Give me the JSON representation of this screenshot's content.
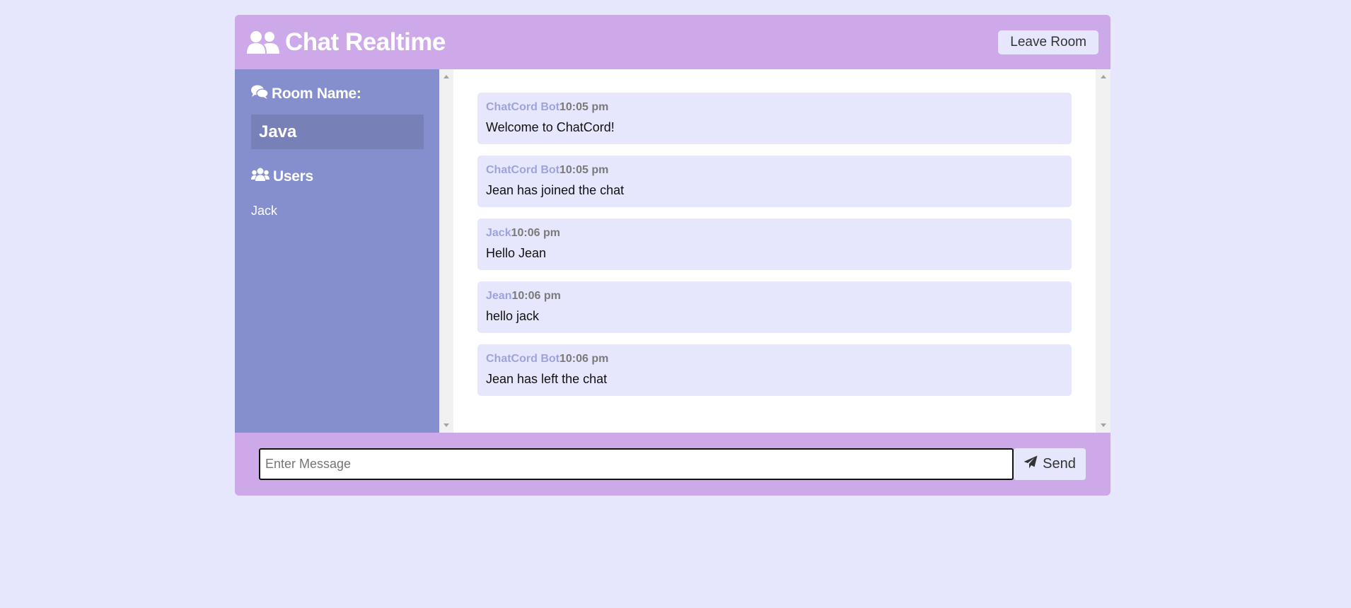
{
  "header": {
    "title": "Chat Realtime",
    "leave_label": "Leave Room"
  },
  "sidebar": {
    "room_heading": "Room Name:",
    "room_name": "Java",
    "users_heading": "Users",
    "users": [
      "Jack"
    ]
  },
  "messages": [
    {
      "name": "ChatCord Bot",
      "time": "10:05 pm",
      "text": "Welcome to ChatCord!"
    },
    {
      "name": "ChatCord Bot",
      "time": "10:05 pm",
      "text": "Jean has joined the chat"
    },
    {
      "name": "Jack",
      "time": "10:06 pm",
      "text": "Hello Jean"
    },
    {
      "name": "Jean",
      "time": "10:06 pm",
      "text": "hello jack"
    },
    {
      "name": "ChatCord Bot",
      "time": "10:06 pm",
      "text": "Jean has left the chat"
    }
  ],
  "form": {
    "placeholder": "Enter Message",
    "value": "",
    "send_label": "Send"
  },
  "colors": {
    "page_bg": "#e6e7fc",
    "header_bg": "#cda9ea",
    "sidebar_bg": "#858fcd",
    "room_name_bg": "#7880b8",
    "message_bg": "#e6e7fc",
    "username": "#9da4dc"
  },
  "icons": {
    "brand": "users-icon",
    "room": "comments-icon",
    "users": "users-icon",
    "send": "paper-plane-icon"
  }
}
